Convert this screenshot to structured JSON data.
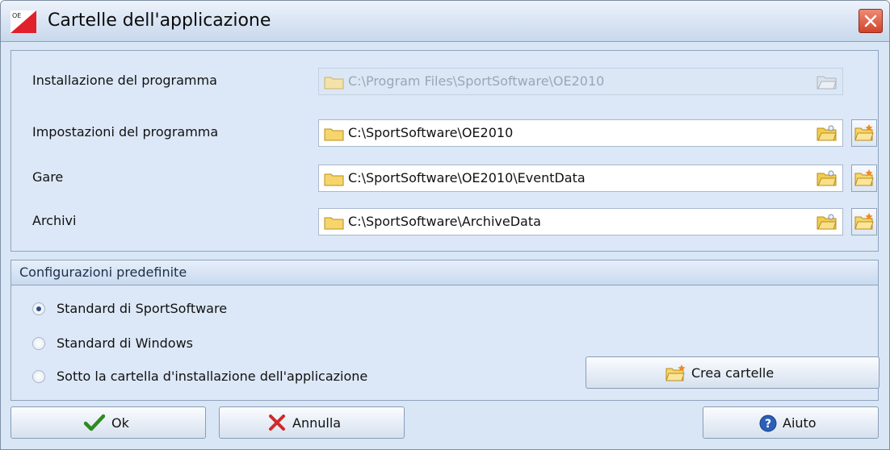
{
  "window": {
    "title": "Cartelle dell'applicazione"
  },
  "paths": [
    {
      "label": "Installazione del programma",
      "value": "C:\\Program Files\\SportSoftware\\OE2010",
      "enabled": false
    },
    {
      "label": "Impostazioni del programma",
      "value": "C:\\SportSoftware\\OE2010",
      "enabled": true
    },
    {
      "label": "Gare",
      "value": "C:\\SportSoftware\\OE2010\\EventData",
      "enabled": true
    },
    {
      "label": "Archivi",
      "value": "C:\\SportSoftware\\ArchiveData",
      "enabled": true
    }
  ],
  "config": {
    "header": "Configurazioni predefinite",
    "options": [
      {
        "label": "Standard di SportSoftware",
        "checked": true
      },
      {
        "label": "Standard di Windows",
        "checked": false
      },
      {
        "label": "Sotto la cartella d'installazione dell'applicazione",
        "checked": false
      }
    ],
    "create_button": "Crea cartelle"
  },
  "buttons": {
    "ok": "Ok",
    "cancel": "Annulla",
    "help": "Aiuto"
  },
  "icons": {
    "app": "oe-app-icon",
    "close": "close-icon",
    "folder": "folder-icon",
    "browse": "browse-folder-icon",
    "new_folder": "new-folder-icon",
    "ok": "checkmark-icon",
    "cancel": "cross-icon",
    "help": "help-icon"
  },
  "colors": {
    "close_red": "#d0442a",
    "ok_green": "#2f8a1f",
    "cancel_red": "#d02a2a",
    "help_blue": "#2c5fb8"
  }
}
